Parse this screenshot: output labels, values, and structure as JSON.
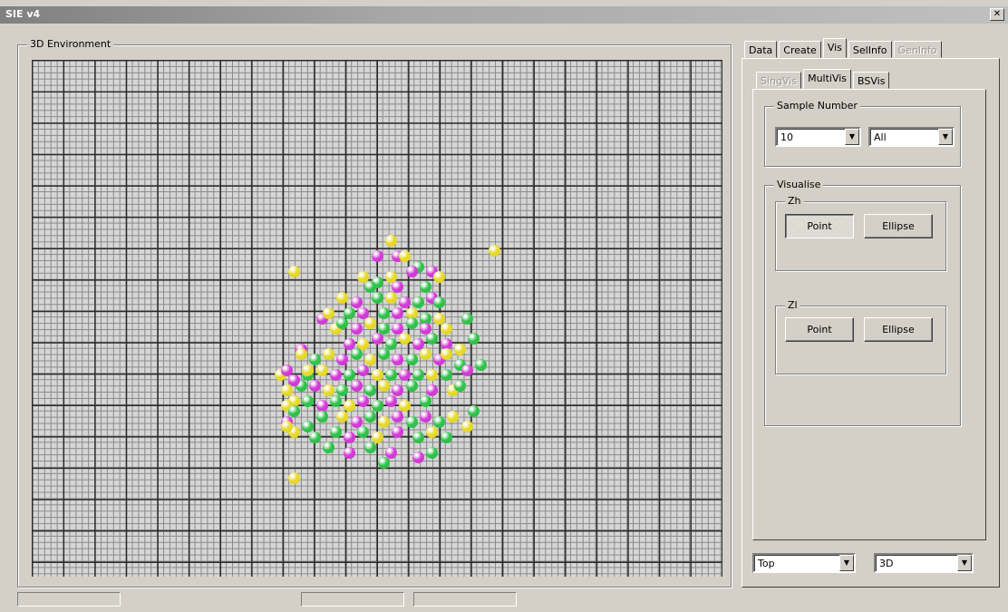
{
  "window": {
    "title": "SIE v4",
    "close_label": "✕"
  },
  "environment": {
    "label": "3D Environment"
  },
  "main_tabs": [
    "Data",
    "Create",
    "Vis",
    "SelInfo",
    "GenInfo"
  ],
  "sub_tabs": [
    "SingVis",
    "MultiVis",
    "BSVis"
  ],
  "sample_number": {
    "label": "Sample Number",
    "count_value": "10",
    "filter_value": "All"
  },
  "visualise": {
    "label": "Visualise",
    "zh": {
      "label": "Zh",
      "point": "Point",
      "ellipse": "Ellipse"
    },
    "zl": {
      "label": "Zl",
      "point": "Point",
      "ellipse": "Ellipse"
    }
  },
  "view": {
    "orientation": "Top",
    "mode": "3D"
  },
  "colors": {
    "magenta": "#d23ad6",
    "green": "#2fc24a",
    "yellow": "#e6d928"
  },
  "points": [
    {
      "c": "yellow",
      "x": 0.38,
      "y": 0.41
    },
    {
      "c": "magenta",
      "x": 0.5,
      "y": 0.38
    },
    {
      "c": "yellow",
      "x": 0.52,
      "y": 0.35
    },
    {
      "c": "yellow",
      "x": 0.67,
      "y": 0.37
    },
    {
      "c": "magenta",
      "x": 0.53,
      "y": 0.38
    },
    {
      "c": "green",
      "x": 0.56,
      "y": 0.4
    },
    {
      "c": "yellow",
      "x": 0.54,
      "y": 0.38
    },
    {
      "c": "magenta",
      "x": 0.58,
      "y": 0.41
    },
    {
      "c": "yellow",
      "x": 0.48,
      "y": 0.42
    },
    {
      "c": "green",
      "x": 0.5,
      "y": 0.43
    },
    {
      "c": "yellow",
      "x": 0.52,
      "y": 0.42
    },
    {
      "c": "magenta",
      "x": 0.55,
      "y": 0.41
    },
    {
      "c": "yellow",
      "x": 0.59,
      "y": 0.42
    },
    {
      "c": "green",
      "x": 0.49,
      "y": 0.44
    },
    {
      "c": "magenta",
      "x": 0.53,
      "y": 0.44
    },
    {
      "c": "green",
      "x": 0.57,
      "y": 0.44
    },
    {
      "c": "yellow",
      "x": 0.45,
      "y": 0.46
    },
    {
      "c": "magenta",
      "x": 0.47,
      "y": 0.47
    },
    {
      "c": "green",
      "x": 0.5,
      "y": 0.46
    },
    {
      "c": "yellow",
      "x": 0.52,
      "y": 0.46
    },
    {
      "c": "magenta",
      "x": 0.54,
      "y": 0.47
    },
    {
      "c": "green",
      "x": 0.56,
      "y": 0.47
    },
    {
      "c": "magenta",
      "x": 0.58,
      "y": 0.46
    },
    {
      "c": "green",
      "x": 0.59,
      "y": 0.47
    },
    {
      "c": "magenta",
      "x": 0.42,
      "y": 0.5
    },
    {
      "c": "yellow",
      "x": 0.43,
      "y": 0.49
    },
    {
      "c": "green",
      "x": 0.46,
      "y": 0.49
    },
    {
      "c": "magenta",
      "x": 0.48,
      "y": 0.49
    },
    {
      "c": "green",
      "x": 0.51,
      "y": 0.49
    },
    {
      "c": "magenta",
      "x": 0.53,
      "y": 0.49
    },
    {
      "c": "yellow",
      "x": 0.55,
      "y": 0.49
    },
    {
      "c": "green",
      "x": 0.57,
      "y": 0.5
    },
    {
      "c": "yellow",
      "x": 0.59,
      "y": 0.5
    },
    {
      "c": "green",
      "x": 0.63,
      "y": 0.5
    },
    {
      "c": "yellow",
      "x": 0.44,
      "y": 0.52
    },
    {
      "c": "green",
      "x": 0.45,
      "y": 0.51
    },
    {
      "c": "magenta",
      "x": 0.47,
      "y": 0.52
    },
    {
      "c": "yellow",
      "x": 0.49,
      "y": 0.51
    },
    {
      "c": "green",
      "x": 0.51,
      "y": 0.52
    },
    {
      "c": "magenta",
      "x": 0.53,
      "y": 0.52
    },
    {
      "c": "green",
      "x": 0.55,
      "y": 0.51
    },
    {
      "c": "magenta",
      "x": 0.57,
      "y": 0.52
    },
    {
      "c": "yellow",
      "x": 0.6,
      "y": 0.52
    },
    {
      "c": "green",
      "x": 0.64,
      "y": 0.54
    },
    {
      "c": "magenta",
      "x": 0.46,
      "y": 0.55
    },
    {
      "c": "yellow",
      "x": 0.48,
      "y": 0.55
    },
    {
      "c": "magenta",
      "x": 0.5,
      "y": 0.54
    },
    {
      "c": "green",
      "x": 0.52,
      "y": 0.55
    },
    {
      "c": "yellow",
      "x": 0.54,
      "y": 0.54
    },
    {
      "c": "magenta",
      "x": 0.56,
      "y": 0.55
    },
    {
      "c": "green",
      "x": 0.58,
      "y": 0.54
    },
    {
      "c": "magenta",
      "x": 0.6,
      "y": 0.55
    },
    {
      "c": "yellow",
      "x": 0.62,
      "y": 0.56
    },
    {
      "c": "magenta",
      "x": 0.39,
      "y": 0.56
    },
    {
      "c": "yellow",
      "x": 0.39,
      "y": 0.57
    },
    {
      "c": "green",
      "x": 0.41,
      "y": 0.58
    },
    {
      "c": "yellow",
      "x": 0.43,
      "y": 0.57
    },
    {
      "c": "magenta",
      "x": 0.45,
      "y": 0.58
    },
    {
      "c": "green",
      "x": 0.47,
      "y": 0.57
    },
    {
      "c": "yellow",
      "x": 0.49,
      "y": 0.58
    },
    {
      "c": "green",
      "x": 0.51,
      "y": 0.57
    },
    {
      "c": "magenta",
      "x": 0.53,
      "y": 0.58
    },
    {
      "c": "green",
      "x": 0.55,
      "y": 0.58
    },
    {
      "c": "yellow",
      "x": 0.57,
      "y": 0.57
    },
    {
      "c": "magenta",
      "x": 0.59,
      "y": 0.58
    },
    {
      "c": "green",
      "x": 0.62,
      "y": 0.59
    },
    {
      "c": "yellow",
      "x": 0.36,
      "y": 0.61
    },
    {
      "c": "magenta",
      "x": 0.37,
      "y": 0.6
    },
    {
      "c": "green",
      "x": 0.4,
      "y": 0.61
    },
    {
      "c": "yellow",
      "x": 0.42,
      "y": 0.6
    },
    {
      "c": "magenta",
      "x": 0.44,
      "y": 0.61
    },
    {
      "c": "green",
      "x": 0.46,
      "y": 0.61
    },
    {
      "c": "magenta",
      "x": 0.48,
      "y": 0.6
    },
    {
      "c": "yellow",
      "x": 0.5,
      "y": 0.61
    },
    {
      "c": "green",
      "x": 0.52,
      "y": 0.61
    },
    {
      "c": "magenta",
      "x": 0.54,
      "y": 0.61
    },
    {
      "c": "green",
      "x": 0.56,
      "y": 0.61
    },
    {
      "c": "yellow",
      "x": 0.58,
      "y": 0.61
    },
    {
      "c": "green",
      "x": 0.6,
      "y": 0.61
    },
    {
      "c": "yellow",
      "x": 0.37,
      "y": 0.64
    },
    {
      "c": "green",
      "x": 0.39,
      "y": 0.63
    },
    {
      "c": "magenta",
      "x": 0.41,
      "y": 0.63
    },
    {
      "c": "yellow",
      "x": 0.43,
      "y": 0.64
    },
    {
      "c": "green",
      "x": 0.45,
      "y": 0.64
    },
    {
      "c": "magenta",
      "x": 0.47,
      "y": 0.63
    },
    {
      "c": "green",
      "x": 0.49,
      "y": 0.64
    },
    {
      "c": "yellow",
      "x": 0.51,
      "y": 0.63
    },
    {
      "c": "magenta",
      "x": 0.53,
      "y": 0.64
    },
    {
      "c": "green",
      "x": 0.55,
      "y": 0.63
    },
    {
      "c": "magenta",
      "x": 0.58,
      "y": 0.64
    },
    {
      "c": "yellow",
      "x": 0.61,
      "y": 0.64
    },
    {
      "c": "yellow",
      "x": 0.38,
      "y": 0.66
    },
    {
      "c": "green",
      "x": 0.4,
      "y": 0.66
    },
    {
      "c": "magenta",
      "x": 0.42,
      "y": 0.67
    },
    {
      "c": "green",
      "x": 0.44,
      "y": 0.66
    },
    {
      "c": "yellow",
      "x": 0.46,
      "y": 0.67
    },
    {
      "c": "magenta",
      "x": 0.48,
      "y": 0.66
    },
    {
      "c": "green",
      "x": 0.5,
      "y": 0.67
    },
    {
      "c": "magenta",
      "x": 0.52,
      "y": 0.66
    },
    {
      "c": "yellow",
      "x": 0.54,
      "y": 0.67
    },
    {
      "c": "green",
      "x": 0.57,
      "y": 0.66
    },
    {
      "c": "yellow",
      "x": 0.4,
      "y": 0.6
    },
    {
      "c": "magenta",
      "x": 0.38,
      "y": 0.62
    },
    {
      "c": "yellow",
      "x": 0.37,
      "y": 0.67
    },
    {
      "c": "green",
      "x": 0.38,
      "y": 0.68
    },
    {
      "c": "magenta",
      "x": 0.37,
      "y": 0.7
    },
    {
      "c": "green",
      "x": 0.4,
      "y": 0.71
    },
    {
      "c": "green",
      "x": 0.42,
      "y": 0.69
    },
    {
      "c": "yellow",
      "x": 0.45,
      "y": 0.69
    },
    {
      "c": "magenta",
      "x": 0.47,
      "y": 0.7
    },
    {
      "c": "green",
      "x": 0.49,
      "y": 0.69
    },
    {
      "c": "yellow",
      "x": 0.51,
      "y": 0.7
    },
    {
      "c": "magenta",
      "x": 0.53,
      "y": 0.69
    },
    {
      "c": "green",
      "x": 0.55,
      "y": 0.7
    },
    {
      "c": "magenta",
      "x": 0.57,
      "y": 0.69
    },
    {
      "c": "green",
      "x": 0.59,
      "y": 0.7
    },
    {
      "c": "yellow",
      "x": 0.61,
      "y": 0.69
    },
    {
      "c": "green",
      "x": 0.44,
      "y": 0.72
    },
    {
      "c": "magenta",
      "x": 0.46,
      "y": 0.73
    },
    {
      "c": "green",
      "x": 0.48,
      "y": 0.72
    },
    {
      "c": "yellow",
      "x": 0.5,
      "y": 0.73
    },
    {
      "c": "magenta",
      "x": 0.53,
      "y": 0.72
    },
    {
      "c": "green",
      "x": 0.56,
      "y": 0.73
    },
    {
      "c": "yellow",
      "x": 0.58,
      "y": 0.72
    },
    {
      "c": "green",
      "x": 0.6,
      "y": 0.73
    },
    {
      "c": "yellow",
      "x": 0.63,
      "y": 0.71
    },
    {
      "c": "green",
      "x": 0.64,
      "y": 0.68
    },
    {
      "c": "green",
      "x": 0.43,
      "y": 0.75
    },
    {
      "c": "magenta",
      "x": 0.46,
      "y": 0.76
    },
    {
      "c": "green",
      "x": 0.49,
      "y": 0.75
    },
    {
      "c": "magenta",
      "x": 0.52,
      "y": 0.76
    },
    {
      "c": "green",
      "x": 0.58,
      "y": 0.76
    },
    {
      "c": "magenta",
      "x": 0.56,
      "y": 0.77
    },
    {
      "c": "green",
      "x": 0.51,
      "y": 0.78
    },
    {
      "c": "yellow",
      "x": 0.38,
      "y": 0.72
    },
    {
      "c": "green",
      "x": 0.41,
      "y": 0.73
    },
    {
      "c": "yellow",
      "x": 0.37,
      "y": 0.71
    },
    {
      "c": "yellow",
      "x": 0.38,
      "y": 0.81
    },
    {
      "c": "green",
      "x": 0.62,
      "y": 0.63
    },
    {
      "c": "magenta",
      "x": 0.63,
      "y": 0.6
    },
    {
      "c": "yellow",
      "x": 0.6,
      "y": 0.57
    },
    {
      "c": "green",
      "x": 0.65,
      "y": 0.59
    }
  ]
}
